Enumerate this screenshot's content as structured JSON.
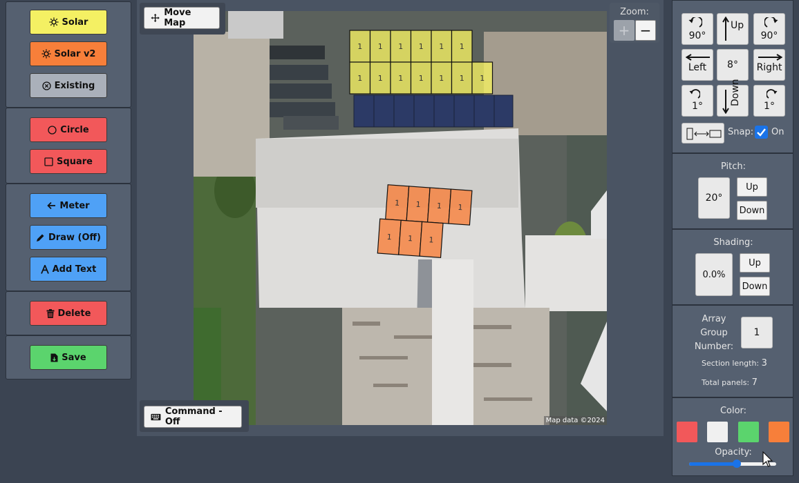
{
  "toolbar": {
    "solar": "Solar",
    "solar_v2": "Solar v2",
    "existing": "Existing",
    "circle": "Circle",
    "square": "Square",
    "meter": "Meter",
    "draw": "Draw (Off)",
    "add_text": "Add Text",
    "delete": "Delete",
    "save": "Save",
    "colors": {
      "solar": "#f4f063",
      "solar_v2": "#f77f3a",
      "existing": "#aab0ba",
      "shape": "#f2585a",
      "tool": "#4fa1f6",
      "delete": "#f2585a",
      "save": "#5bd46d"
    }
  },
  "map": {
    "move_map": "Move Map",
    "command": "Command - Off",
    "attribution": "Map data ©2024",
    "zoom": {
      "label": "Zoom:",
      "plus": "+",
      "minus": "−"
    },
    "panel_label": "1"
  },
  "controls": {
    "rotate_ccw_90": "90°",
    "up": "Up",
    "rotate_cw_90": "90°",
    "left": "Left",
    "step": "8°",
    "right": "Right",
    "rotate_ccw_1": "1°",
    "down": "Down",
    "rotate_cw_1": "1°",
    "snap_label": "Snap:",
    "snap_state": "On"
  },
  "pitch": {
    "label": "Pitch:",
    "value": "20°",
    "up": "Up",
    "down": "Down"
  },
  "shading": {
    "label": "Shading:",
    "value": "0.0%",
    "up": "Up",
    "down": "Down"
  },
  "array": {
    "group_label": "Array\nGroup\nNumber:",
    "group_value": "1",
    "section_length_label": "Section length:",
    "section_length": "3",
    "total_panels_label": "Total panels:",
    "total_panels": "7"
  },
  "color": {
    "label": "Color:",
    "swatches": [
      "#f2585a",
      "#f0f0f0",
      "#5bd46d",
      "#f77f3a"
    ],
    "opacity_label": "Opacity:",
    "opacity": 0.55
  }
}
